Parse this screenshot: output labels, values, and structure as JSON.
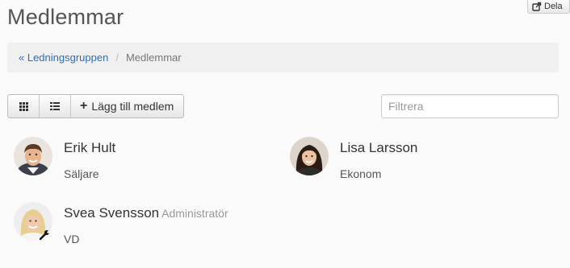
{
  "page": {
    "title": "Medlemmar"
  },
  "share_button": {
    "label": "Dela",
    "icon": "share-icon"
  },
  "breadcrumb": {
    "parent_label": "« Ledningsgruppen",
    "separator": "/",
    "current_label": "Medlemmar"
  },
  "toolbar": {
    "grid_view_icon": "grid-icon",
    "list_view_icon": "list-icon",
    "add_member_icon": "plus-icon",
    "add_member_label": "Lägg till medlem"
  },
  "filter": {
    "placeholder": "Filtrera",
    "value": ""
  },
  "members": [
    {
      "name": "Erik Hult",
      "role": "",
      "title": "Säljare",
      "admin_icon": ""
    },
    {
      "name": "Lisa Larsson",
      "role": "",
      "title": "Ekonom",
      "admin_icon": ""
    },
    {
      "name": "Svea Svensson",
      "role": "Administratör",
      "title": "VD",
      "admin_icon": "wrench-icon"
    }
  ],
  "colors": {
    "link": "#2a6ebb",
    "background": "#fafafa",
    "breadcrumb_bg": "#f0f0f0"
  }
}
